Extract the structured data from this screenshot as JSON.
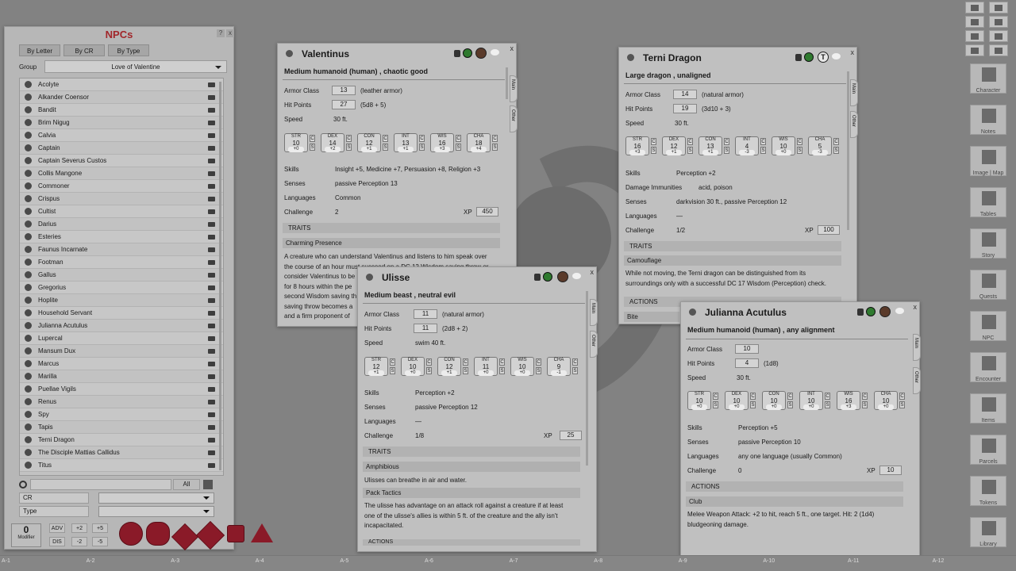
{
  "npcs": {
    "title": "NPCs",
    "help": "?",
    "close": "x",
    "tabs": [
      "By Letter",
      "By CR",
      "By Type"
    ],
    "group_label": "Group",
    "group_value": "Love of Valentine",
    "items": [
      "Acolyte",
      "Alkander Coensor",
      "Bandit",
      "Brim Nigug",
      "Calvia",
      "Captain",
      "Captain Severus Custos",
      "Collis Mangone",
      "Commoner",
      "Crispus",
      "Cultist",
      "Darius",
      "Esteries",
      "Faunus Incarnate",
      "Footman",
      "Gallus",
      "Gregorius",
      "Hoplite",
      "Household Servant",
      "Julianna Acutulus",
      "Lupercal",
      "Mansum Dux",
      "Marcus",
      "Marilla",
      "Puellae Vigils",
      "Renus",
      "Spy",
      "Tapis",
      "Terni Dragon",
      "The Disciple Mattias Callidus",
      "Titus"
    ],
    "all_label": "All",
    "cr_label": "CR",
    "type_label": "Type"
  },
  "modifier": {
    "value": "0",
    "label": "Modifier",
    "adv": "ADV",
    "dis": "DIS",
    "p2": "+2",
    "p5": "+5",
    "m2": "-2",
    "m5": "-5"
  },
  "dice": [
    "d4",
    "d6",
    "d8",
    "d10",
    "d12",
    "d20"
  ],
  "sheets": {
    "valentinus": {
      "name": "Valentinus",
      "subtitle": "Medium humanoid (human) , chaotic good",
      "ac_label": "Armor Class",
      "ac": "13",
      "ac_note": "(leather armor)",
      "hp_label": "Hit Points",
      "hp": "27",
      "hp_note": "(5d8 + 5)",
      "speed_label": "Speed",
      "speed": "30 ft.",
      "abilities": [
        {
          "n": "STR",
          "v": "10",
          "m": "+0"
        },
        {
          "n": "DEX",
          "v": "14",
          "m": "+2"
        },
        {
          "n": "CON",
          "v": "12",
          "m": "+1"
        },
        {
          "n": "INT",
          "v": "13",
          "m": "+1"
        },
        {
          "n": "WIS",
          "v": "16",
          "m": "+3"
        },
        {
          "n": "CHA",
          "v": "18",
          "m": "+4"
        }
      ],
      "skills_label": "Skills",
      "skills": "Insight +5, Medicine +7, Persuasion +8, Religion +3",
      "senses_label": "Senses",
      "senses": "passive Perception 13",
      "languages_label": "Languages",
      "languages": "Common",
      "challenge_label": "Challenge",
      "challenge": "2",
      "xp_label": "XP",
      "xp": "450",
      "traits_label": "TRAITS",
      "trait_name": "Charming Presence",
      "trait_text": [
        "A creature who can understand Valentinus and listens to him speak over",
        "the course of an hour must succeed on a DC 12 Wisdom saving throw or",
        "consider Valentinus to be",
        "for 8 hours within the pe",
        "second Wisdom saving th",
        "saving throw becomes a",
        "and a firm proponent of"
      ],
      "tab_main": "Main",
      "tab_other": "Other"
    },
    "terni": {
      "name": "Terni Dragon",
      "subtitle": "Large dragon , unaligned",
      "ac_label": "Armor Class",
      "ac": "14",
      "ac_note": "(natural armor)",
      "hp_label": "Hit Points",
      "hp": "19",
      "hp_note": "(3d10 + 3)",
      "speed_label": "Speed",
      "speed": "30 ft.",
      "abilities": [
        {
          "n": "STR",
          "v": "16",
          "m": "+3"
        },
        {
          "n": "DEX",
          "v": "12",
          "m": "+1"
        },
        {
          "n": "CON",
          "v": "13",
          "m": "+1"
        },
        {
          "n": "INT",
          "v": "4",
          "m": "-3"
        },
        {
          "n": "WIS",
          "v": "10",
          "m": "+0"
        },
        {
          "n": "CHA",
          "v": "5",
          "m": "-3"
        }
      ],
      "skills_label": "Skills",
      "skills": "Perception +2",
      "immun_label": "Damage Immunities",
      "immun": "acid, poison",
      "senses_label": "Senses",
      "senses": "darkvision 30 ft., passive Perception 12",
      "languages_label": "Languages",
      "languages": "—",
      "challenge_label": "Challenge",
      "challenge": "1/2",
      "xp_label": "XP",
      "xp": "100",
      "traits_label": "TRAITS",
      "trait_name": "Camouflage",
      "trait_text": [
        "While not moving, the Terni dragon can be distinguished from its",
        "surroundings only with a successful DC 17 Wisdom (Perception) check."
      ],
      "actions_label": "ACTIONS",
      "action_name": "Bite",
      "tab_main": "Main",
      "tab_other": "Other",
      "t_badge": "T"
    },
    "ulisse": {
      "name": "Ulisse",
      "subtitle": "Medium beast , neutral evil",
      "ac_label": "Armor Class",
      "ac": "11",
      "ac_note": "(natural armor)",
      "hp_label": "Hit Points",
      "hp": "11",
      "hp_note": "(2d8 + 2)",
      "speed_label": "Speed",
      "speed": "swim 40 ft.",
      "abilities": [
        {
          "n": "STR",
          "v": "12",
          "m": "+1"
        },
        {
          "n": "DEX",
          "v": "10",
          "m": "+0"
        },
        {
          "n": "CON",
          "v": "12",
          "m": "+1"
        },
        {
          "n": "INT",
          "v": "11",
          "m": "+0"
        },
        {
          "n": "WIS",
          "v": "10",
          "m": "+0"
        },
        {
          "n": "CHA",
          "v": "9",
          "m": "-1"
        }
      ],
      "skills_label": "Skills",
      "skills": "Perception +2",
      "senses_label": "Senses",
      "senses": "passive Perception 12",
      "languages_label": "Languages",
      "languages": "—",
      "challenge_label": "Challenge",
      "challenge": "1/8",
      "xp_label": "XP",
      "xp": "25",
      "traits_label": "TRAITS",
      "trait1_name": "Amphibious",
      "trait1_text": "Ulisses can breathe in air and water.",
      "trait2_name": "Pack Tactics",
      "trait2_text": [
        "The ulisse has advantage on an attack roll against a creature if at least",
        "one of the ulisse's allies is within 5 ft. of the creature and the ally isn't",
        "incapacitated."
      ],
      "actions_label": "ACTIONS",
      "tab_main": "Main",
      "tab_other": "Other"
    },
    "julianna": {
      "name": "Julianna Acutulus",
      "subtitle": "Medium humanoid (human) , any alignment",
      "ac_label": "Armor Class",
      "ac": "10",
      "hp_label": "Hit Points",
      "hp": "4",
      "hp_note": "(1d8)",
      "speed_label": "Speed",
      "speed": "30 ft.",
      "abilities": [
        {
          "n": "STR",
          "v": "10",
          "m": "+0"
        },
        {
          "n": "DEX",
          "v": "10",
          "m": "+0"
        },
        {
          "n": "CON",
          "v": "10",
          "m": "+0"
        },
        {
          "n": "INT",
          "v": "10",
          "m": "+0"
        },
        {
          "n": "WIS",
          "v": "16",
          "m": "+3"
        },
        {
          "n": "CHA",
          "v": "10",
          "m": "+0"
        }
      ],
      "skills_label": "Skills",
      "skills": "Perception +5",
      "senses_label": "Senses",
      "senses": "passive Perception 10",
      "languages_label": "Languages",
      "languages": "any one language (usually Common)",
      "challenge_label": "Challenge",
      "challenge": "0",
      "xp_label": "XP",
      "xp": "10",
      "actions_label": "ACTIONS",
      "action_name": "Club",
      "action_text": [
        "Melee Weapon Attack: +2 to hit, reach 5 ft., one target. Hit: 2 (1d4)",
        "bludgeoning damage."
      ],
      "tab_main": "Main",
      "tab_other": "Other"
    }
  },
  "sidebar": [
    "Character",
    "Notes",
    "Image | Map",
    "Tables",
    "Story",
    "Quests",
    "NPC",
    "Encounter",
    "Items",
    "Parcels",
    "Tokens",
    "Library"
  ],
  "hotkeys": [
    "A-1",
    "A-2",
    "A-3",
    "A-4",
    "A-5",
    "A-6",
    "A-7",
    "A-8",
    "A-9",
    "A-10",
    "A-11",
    "A-12"
  ]
}
